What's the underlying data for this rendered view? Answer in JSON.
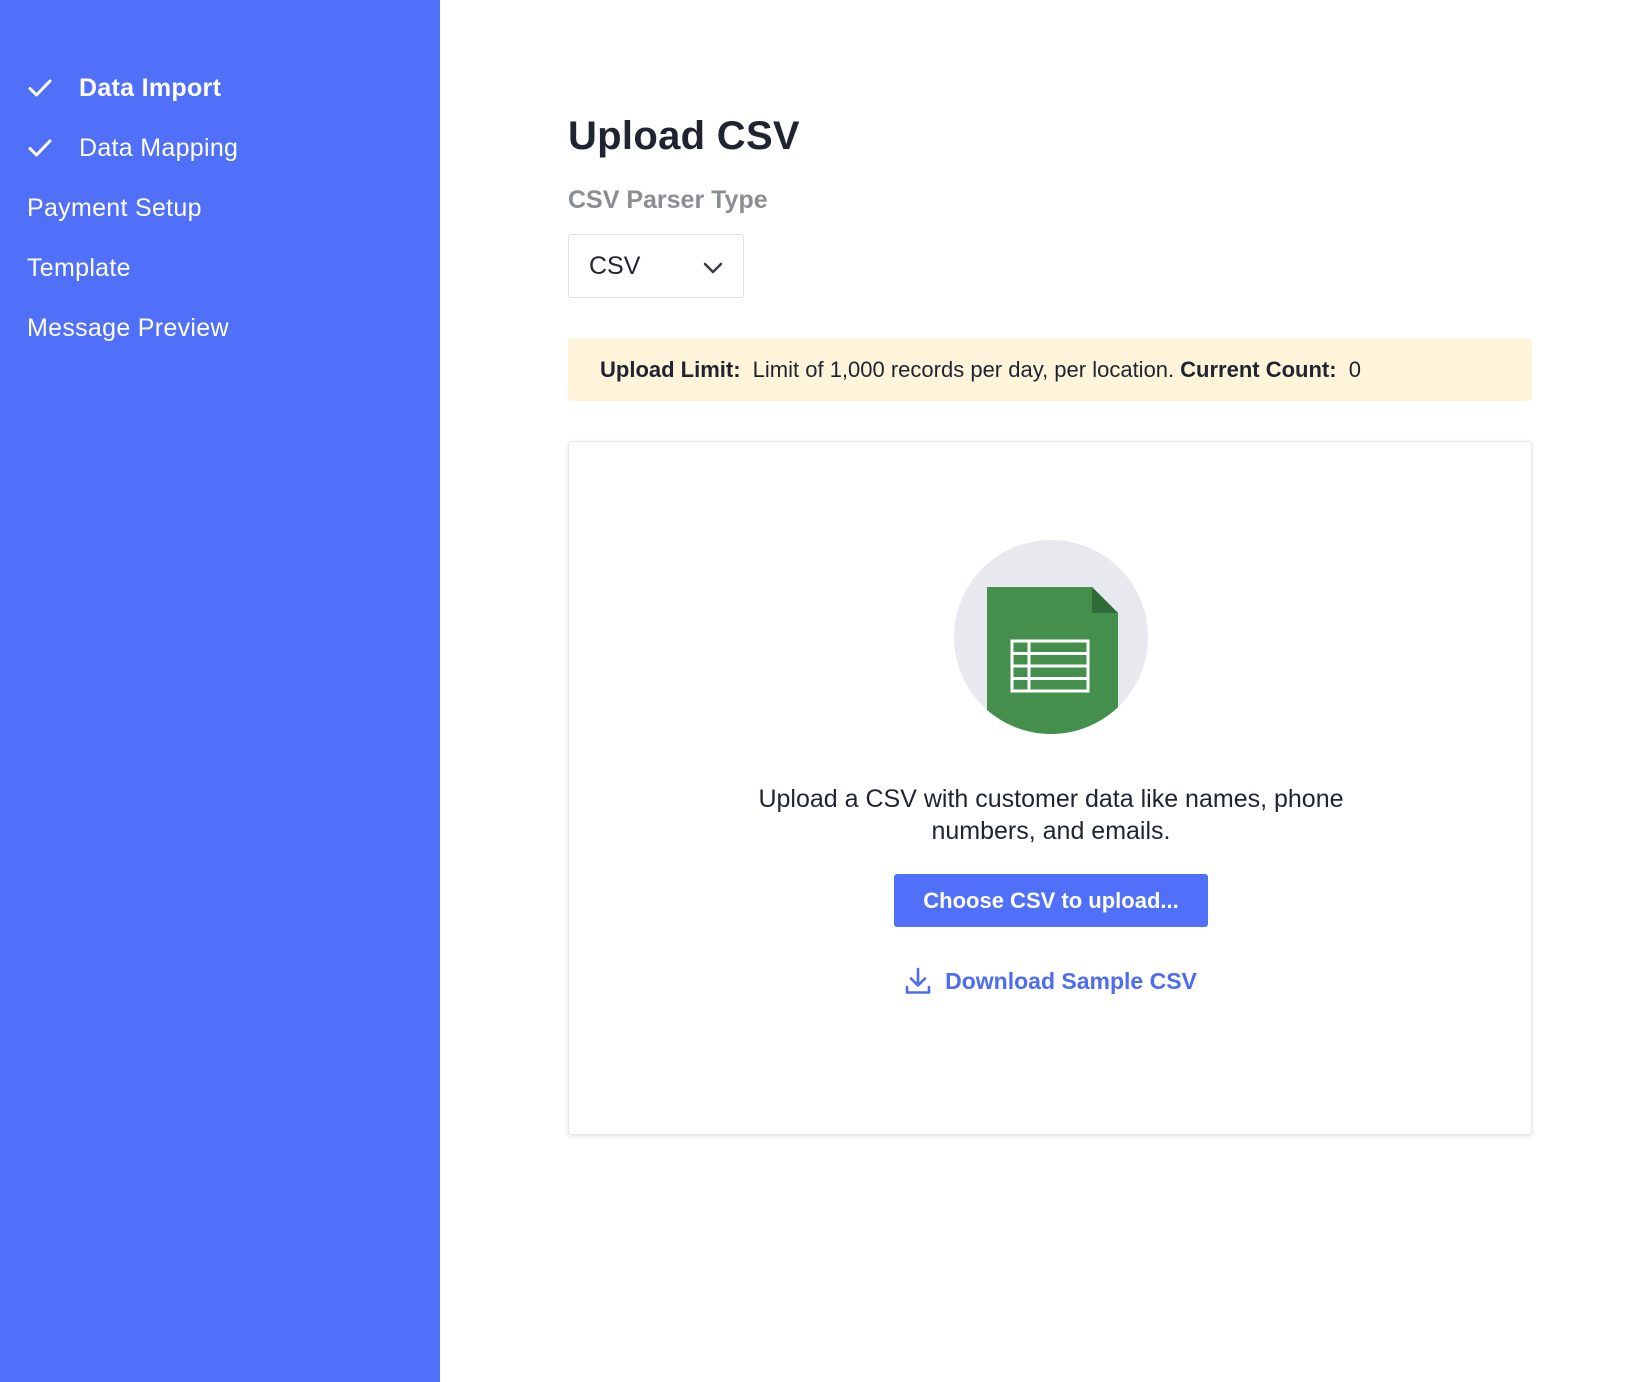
{
  "colors": {
    "sidebar_bg": "#5170f9",
    "primary": "#5170f9",
    "link": "#4d6cf2",
    "notice_bg": "#fdf4da",
    "file_green": "#458f4d",
    "illustration_circle": "#e7e9ef"
  },
  "sidebar": {
    "items": [
      {
        "label": "Data Import",
        "icon": "check-icon",
        "completed": true,
        "active": true
      },
      {
        "label": "Data Mapping",
        "icon": "check-icon",
        "completed": true,
        "active": false
      },
      {
        "label": "Payment Setup",
        "completed": false,
        "active": false
      },
      {
        "label": "Template",
        "completed": false,
        "active": false
      },
      {
        "label": "Message Preview",
        "completed": false,
        "active": false
      }
    ]
  },
  "main": {
    "title": "Upload CSV",
    "parser": {
      "label": "CSV Parser Type",
      "selected": "CSV",
      "icon": "chevron-down-icon"
    },
    "notice": {
      "limit_label": "Upload Limit:",
      "limit_text": "Limit of 1,000 records per day, per location.",
      "count_label": "Current Count:",
      "count_value": "0"
    },
    "upload": {
      "illustration_icon": "spreadsheet-file-icon",
      "description": "Upload a CSV with customer data like names, phone numbers, and emails.",
      "button_label": "Choose CSV to upload...",
      "download_label": "Download Sample CSV",
      "download_icon": "download-icon"
    }
  }
}
